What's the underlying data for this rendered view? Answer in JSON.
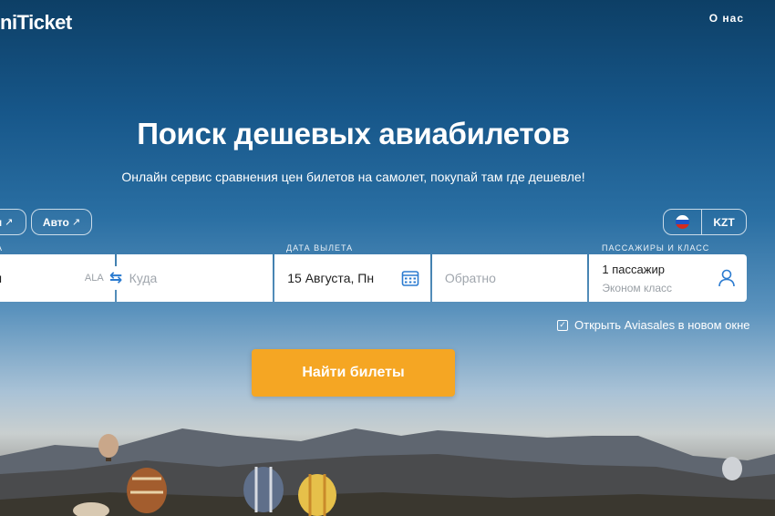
{
  "header": {
    "logo_text": "niTicket",
    "about_link": "О нас"
  },
  "hero": {
    "title": "Поиск дешевых авиабилетов",
    "subtitle": "Онлайн сервис сравнения цен билетов на самолет, покупай там где дешевле!"
  },
  "chips": {
    "hotels_label": "и",
    "auto_label": "Авто",
    "external_icon": "arrow-up-right-icon"
  },
  "locale": {
    "flag": "russia-flag-icon",
    "currency": "KZT"
  },
  "form": {
    "from_caption": "А",
    "depart_caption": "ДАТА ВЫЛЕТА",
    "passengers_caption": "ПАССАЖИРЫ И КЛАСС",
    "from_value": "ы",
    "from_iata": "ALA",
    "to_placeholder": "Куда",
    "depart_value": "15 Августа, Пн",
    "return_placeholder": "Обратно",
    "passengers_count": "1 пассажир",
    "passengers_class": "Эконом класс"
  },
  "options": {
    "new_window_label": "Открыть Aviasales в новом окне",
    "new_window_checked": true
  },
  "search_button_label": "Найти билеты",
  "colors": {
    "accent": "#f5a623",
    "icon_blue": "#2b7bd0"
  }
}
